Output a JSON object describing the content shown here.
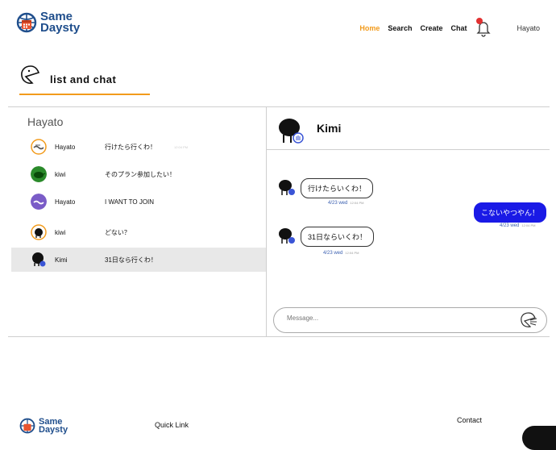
{
  "brand": {
    "line1": "Same",
    "line2": "Daysty"
  },
  "nav": {
    "home": "Home",
    "search": "Search",
    "create": "Create",
    "chat": "Chat",
    "user": "Hayato"
  },
  "page": {
    "title": "list and chat"
  },
  "list": {
    "owner": "Hayato",
    "rows": [
      {
        "name": "Hayato",
        "message": "行けたら行くわ！",
        "time": "12:04 PM"
      },
      {
        "name": "kiwi",
        "message": "そのプラン参加したい！"
      },
      {
        "name": "Hayato",
        "message": "I WANT TO JOIN"
      },
      {
        "name": "kiwi",
        "message": "どない？"
      },
      {
        "name": "Kimi",
        "message": "31日なら行くわ！"
      }
    ]
  },
  "chat": {
    "partner": "Kimi",
    "messages": [
      {
        "text": "行けたらいくわ！",
        "date": "4/23 wed",
        "time": "12:04 PM"
      },
      {
        "text": "こないやつやん！",
        "date": "4/23 wed",
        "time": "12:04 PM"
      },
      {
        "text": "31日ならいくわ！",
        "date": "4/23 wed",
        "time": "12:04 PM"
      }
    ],
    "input_placeholder": "Message..."
  },
  "footer": {
    "quick_link": "Quick Link",
    "contact": "Contact"
  },
  "colors": {
    "brand_blue": "#1f4e8c",
    "accent_orange": "#f29b1c",
    "my_bubble": "#1a1ae6",
    "notify_red": "#e23131"
  }
}
